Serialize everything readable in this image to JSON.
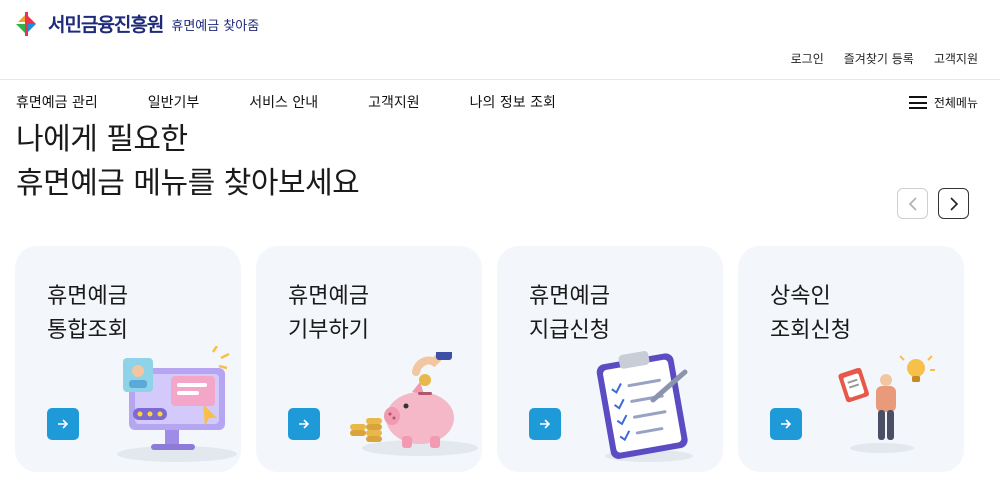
{
  "header": {
    "logo_name": "서민금융진흥원",
    "logo_sub": "휴면예금 찾아줌",
    "util_links": [
      "로그인",
      "즐겨찾기 등록",
      "고객지원"
    ]
  },
  "gnb": {
    "items": [
      "휴면예금 관리",
      "일반기부",
      "서비스 안내",
      "고객지원",
      "나의 정보 조회"
    ],
    "all_menu_label": "전체메뉴"
  },
  "hero": {
    "line1": "나에게 필요한",
    "line2": "휴면예금 메뉴를 찾아보세요"
  },
  "cards": [
    {
      "line1": "휴면예금",
      "line2": "통합조회",
      "icon": "monitor-icon"
    },
    {
      "line1": "휴면예금",
      "line2": "기부하기",
      "icon": "piggy-bank-icon"
    },
    {
      "line1": "휴면예금",
      "line2": "지급신청",
      "icon": "clipboard-icon"
    },
    {
      "line1": "상속인",
      "line2": "조회신청",
      "icon": "person-idea-icon"
    }
  ],
  "colors": {
    "brand_navy": "#1f2a7a",
    "logo_red": "#e8344e",
    "logo_green": "#2cb34a",
    "logo_blue": "#1d8fd6",
    "button_blue": "#1e9ad8",
    "card_bg": "#f3f6fa"
  }
}
